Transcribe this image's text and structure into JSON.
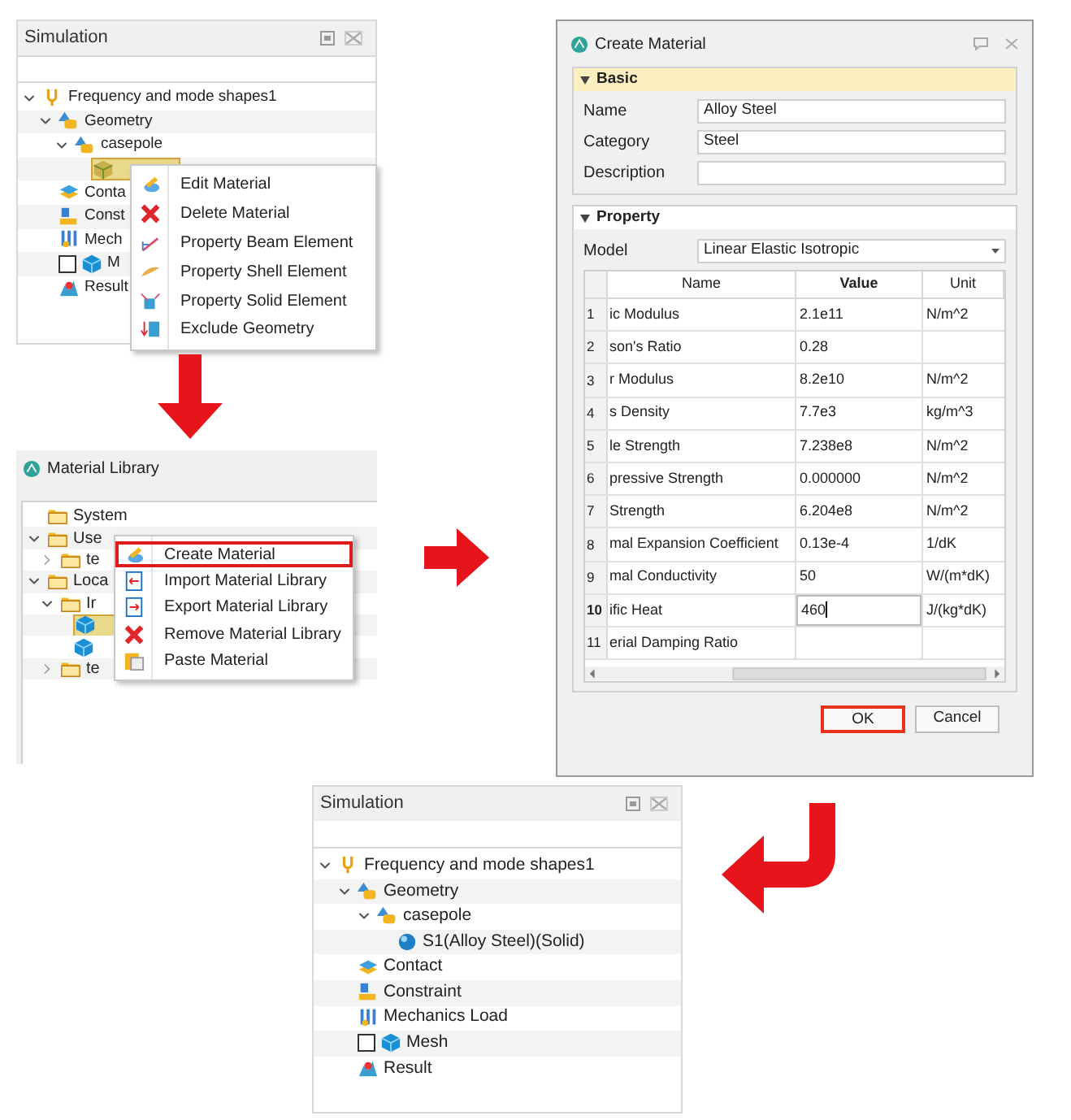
{
  "simulation_before": {
    "title": "Simulation",
    "tree": [
      {
        "label": "Frequency and mode shapes1",
        "kind": "study",
        "expanded": true,
        "selected": false,
        "children": [
          {
            "label": "Geometry",
            "kind": "geometry",
            "expanded": true,
            "selected": false,
            "children": [
              {
                "label": "casepole",
                "kind": "part",
                "expanded": true,
                "selected": false,
                "children": [
                  {
                    "kind": "body",
                    "selected": true
                  }
                ]
              }
            ]
          },
          {
            "label": "Conta",
            "kind": "contact",
            "selected": false
          },
          {
            "label": "Const",
            "kind": "constraint",
            "selected": false
          },
          {
            "label": "Mech",
            "kind": "load",
            "selected": false
          },
          {
            "label": "M",
            "kind": "mesh",
            "checked": false,
            "selected": false
          },
          {
            "label": "Result",
            "kind": "result",
            "selected": false
          }
        ]
      }
    ],
    "context_menu": [
      {
        "label": "Edit Material",
        "kind": "paint",
        "highlighted": false
      },
      {
        "label": "Delete Material",
        "kind": "delete",
        "highlighted": false
      },
      {
        "label": "Property Beam Element",
        "kind": "beam",
        "highlighted": false
      },
      {
        "label": "Property Shell Element",
        "kind": "shell",
        "highlighted": false
      },
      {
        "label": "Property Solid Element",
        "kind": "solid",
        "highlighted": false
      },
      {
        "label": "Exclude Geometry",
        "kind": "exclude",
        "highlighted": false
      }
    ]
  },
  "material_library": {
    "title": "Material Library",
    "tree": [
      {
        "label": "System",
        "kind": "folder",
        "selected": false
      },
      {
        "label": "Use",
        "kind": "folder",
        "expanded": true,
        "selected": false,
        "children": [
          {
            "label": "te",
            "kind": "folder",
            "expanded": false,
            "selected": false
          }
        ]
      },
      {
        "label": "Loca",
        "kind": "folder",
        "expanded": true,
        "selected": false,
        "children": [
          {
            "label": "Ir",
            "kind": "folder",
            "expanded": true,
            "selected": false,
            "children": [
              {
                "kind": "material",
                "selected": true
              },
              {
                "kind": "material",
                "selected": false
              }
            ]
          },
          {
            "label": "te",
            "kind": "folder",
            "expanded": false,
            "selected": false
          }
        ]
      }
    ],
    "context_menu": [
      {
        "label": "Create Material",
        "kind": "paint",
        "highlighted": true
      },
      {
        "label": "Import Material Library",
        "kind": "import",
        "highlighted": false
      },
      {
        "label": "Export Material Library",
        "kind": "export",
        "highlighted": false
      },
      {
        "label": "Remove Material Library",
        "kind": "delete",
        "highlighted": false
      },
      {
        "label": "Paste Material",
        "kind": "paste",
        "highlighted": false
      }
    ]
  },
  "create_material": {
    "title": "Create Material",
    "sections": [
      {
        "title": "Basic",
        "expanded": true,
        "active": true,
        "fields": [
          {
            "label": "Name",
            "value": "Alloy Steel"
          },
          {
            "label": "Category",
            "value": "Steel"
          },
          {
            "label": "Description"
          }
        ]
      },
      {
        "title": "Property",
        "expanded": true,
        "active": false,
        "model": {
          "label": "Model",
          "value": "Linear Elastic Isotropic"
        },
        "table": {
          "columns": [
            "Name",
            "Value",
            "Unit"
          ],
          "rows": [
            {
              "number": "1",
              "name": "ic Modulus",
              "value": "2.1e11",
              "unit": "N/m^2",
              "editing": false
            },
            {
              "number": "2",
              "name": "son's Ratio",
              "value": "0.28",
              "editing": false
            },
            {
              "number": "3",
              "name": "r Modulus",
              "value": "8.2e10",
              "unit": "N/m^2",
              "editing": false
            },
            {
              "number": "4",
              "name": "s Density",
              "value": "7.7e3",
              "unit": "kg/m^3",
              "editing": false
            },
            {
              "number": "5",
              "name": "le Strength",
              "value": "7.238e8",
              "unit": "N/m^2",
              "editing": false
            },
            {
              "number": "6",
              "name": "pressive Strength",
              "value": "0.000000",
              "unit": "N/m^2",
              "editing": false
            },
            {
              "number": "7",
              "name": "Strength",
              "value": "6.204e8",
              "unit": "N/m^2",
              "editing": false
            },
            {
              "number": "8",
              "name": "mal Expansion Coefficient",
              "value": "0.13e-4",
              "unit": "1/dK",
              "editing": false
            },
            {
              "number": "9",
              "name": "mal Conductivity",
              "value": "50",
              "unit": "W/(m*dK)",
              "editing": false
            },
            {
              "number": "10",
              "name": "ific Heat",
              "value": "460",
              "unit": "J/(kg*dK)",
              "editing": true
            },
            {
              "number": "11",
              "name": "erial Damping Ratio",
              "editing": false
            }
          ]
        }
      }
    ],
    "buttons": [
      {
        "label": "OK",
        "highlighted": true
      },
      {
        "label": "Cancel",
        "highlighted": false
      }
    ]
  },
  "simulation_after": {
    "title": "Simulation",
    "tree": [
      {
        "label": "Frequency and mode shapes1",
        "kind": "study",
        "expanded": true,
        "children": [
          {
            "label": "Geometry",
            "kind": "geometry",
            "expanded": true,
            "children": [
              {
                "label": "casepole",
                "kind": "part",
                "expanded": true,
                "children": [
                  {
                    "label": "S1(Alloy Steel)(Solid)",
                    "kind": "material_body"
                  }
                ]
              }
            ]
          },
          {
            "label": "Contact",
            "kind": "contact"
          },
          {
            "label": "Constraint",
            "kind": "constraint"
          },
          {
            "label": "Mechanics Load",
            "kind": "load"
          },
          {
            "label": "Mesh",
            "kind": "mesh",
            "checked": false
          },
          {
            "label": "Result",
            "kind": "result"
          }
        ]
      }
    ]
  }
}
